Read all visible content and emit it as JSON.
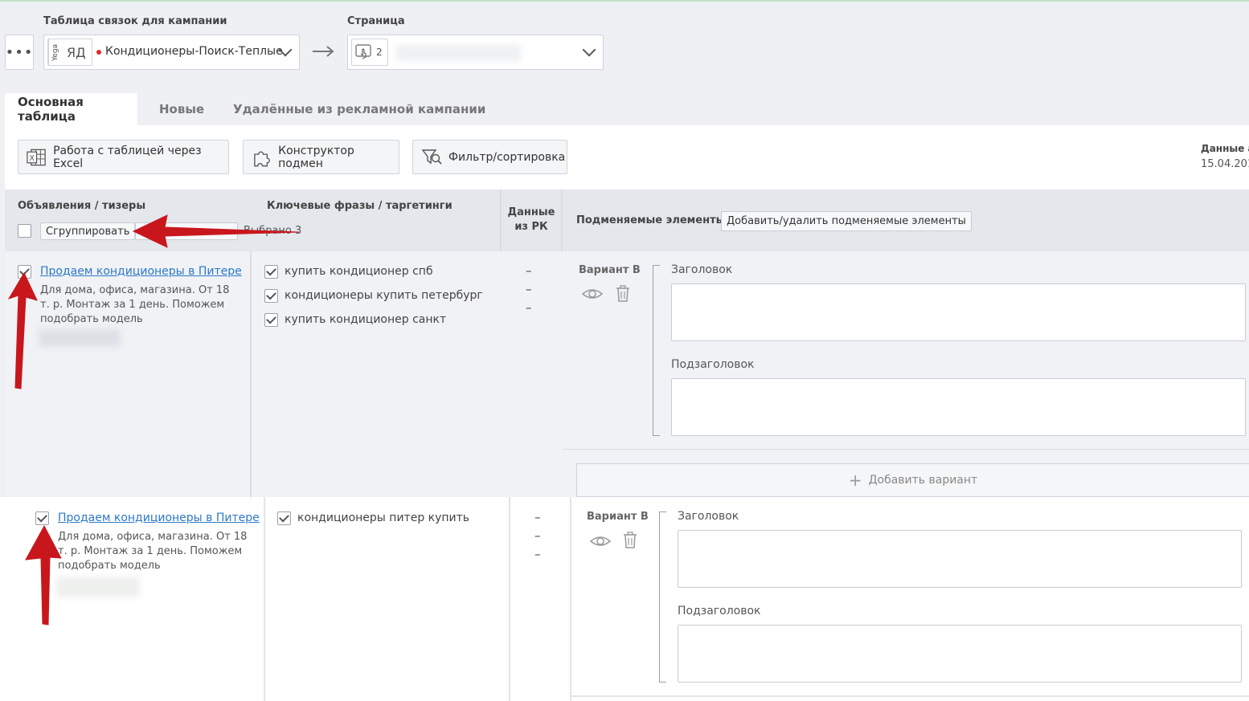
{
  "header": {
    "campaign_label": "Таблица связок для кампании",
    "page_label": "Страница",
    "source_vertical": "Yega",
    "source_short": "ЯД",
    "campaign_name": "Кондиционеры-Поиск-Теплые",
    "page_count": "2"
  },
  "tabs": [
    {
      "label": "Основная таблица",
      "active": true
    },
    {
      "label": "Новые",
      "active": false
    },
    {
      "label": "Удалённые из рекламной кампании",
      "active": false
    }
  ],
  "toolbar": {
    "excel_label": "Работа с таблицей через Excel",
    "constructor_label": "Конструктор подмен",
    "filter_label": "Фильтр/сортировка",
    "data_label": "Данные а",
    "data_date": "15.04.201"
  },
  "table_header": {
    "ads_title": "Объявления / тизеры",
    "group_button": "Сгруппировать",
    "selected_text": "Выбрано 3",
    "keywords_title": "Ключевые фразы / таргетинги",
    "rk_data_line1": "Данные",
    "rk_data_line2": "из РК",
    "replace_title": "Подменяемые элементы",
    "replace_button": "Добавить/удалить подменяемые элементы"
  },
  "rows": [
    {
      "ad_title": "Продаем кондиционеры в Питере",
      "ad_desc": "Для дома, офиса, магазина. От 18 т. р. Монтаж за 1 день. Поможем подобрать модель",
      "keywords": [
        "купить кондиционер спб",
        "кондиционеры купить петербург",
        "купить кондиционер санкт"
      ],
      "dashes": [
        "–",
        "–",
        "–"
      ],
      "variant": "Вариант В",
      "field1": "Заголовок",
      "field2": "Подзаголовок",
      "add_variant": "Добавить вариант"
    },
    {
      "ad_title": "Продаем кондиционеры в Питере",
      "ad_desc": "Для дома, офиса, магазина. От 18 т. р. Монтаж за 1 день. Поможем подобрать модель",
      "keywords": [
        "кондиционеры питер купить"
      ],
      "dashes": [
        "–",
        "–",
        "–"
      ],
      "variant": "Вариант В",
      "field1": "Заголовок",
      "field2": "Подзаголовок"
    }
  ],
  "colors": {
    "link": "#2c78c8",
    "arrow": "#c8161d",
    "status_dot": "#d92b2b"
  }
}
